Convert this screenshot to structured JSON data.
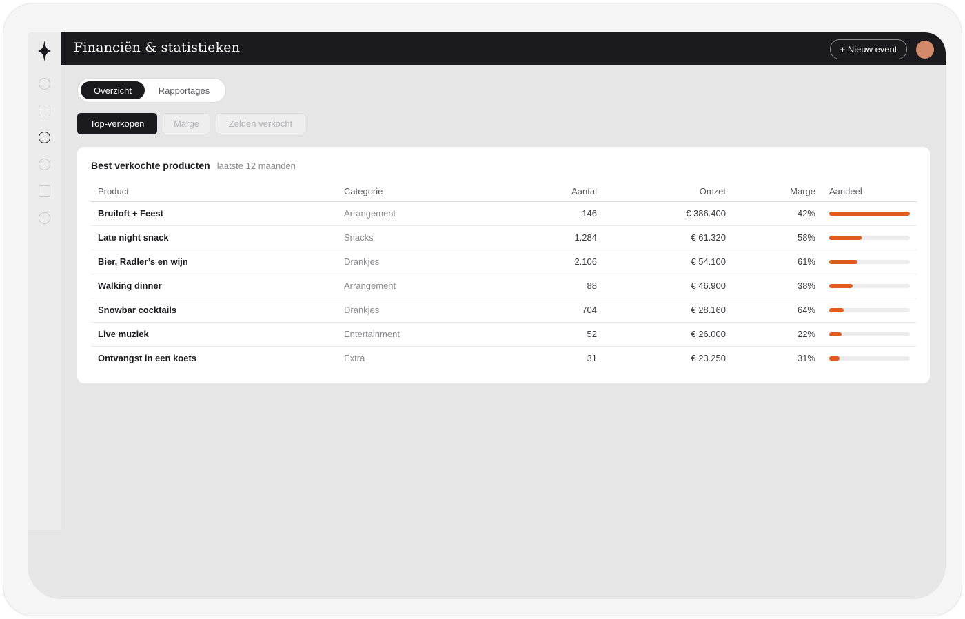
{
  "app": {
    "title": "Financiën & statistieken",
    "new_event_label": "+ Nieuw event",
    "accent_color": "#e05c1f",
    "dark_color": "#1b1b1f"
  },
  "rail": {
    "logo_icon": "four-point-star-icon",
    "items": [
      {
        "shape": "circle",
        "active": false
      },
      {
        "shape": "square",
        "active": false
      },
      {
        "shape": "circle",
        "active": true
      },
      {
        "shape": "circle",
        "active": false
      },
      {
        "shape": "square",
        "active": false
      },
      {
        "shape": "circle",
        "active": false
      }
    ]
  },
  "tabs": {
    "overview": "Overzicht",
    "reports": "Rapportages"
  },
  "filters": {
    "top": "Top-verkopen",
    "margin": "Marge",
    "rarely": "Zelden verkocht"
  },
  "card": {
    "title": "Best verkochte producten",
    "subtitle": "laatste 12 maanden",
    "columns": {
      "product": "Product",
      "category": "Categorie",
      "quantity": "Aantal",
      "revenue": "Omzet",
      "margin": "Marge",
      "share": "Aandeel"
    },
    "rows": [
      {
        "product": "Bruiloft + Feest",
        "category": "Arrangement",
        "quantity": "146",
        "revenue": "€ 386.400",
        "margin": "42%",
        "share": 1.0
      },
      {
        "product": "Late night snack",
        "category": "Snacks",
        "quantity": "1.284",
        "revenue": "€ 61.320",
        "margin": "58%",
        "share": 0.4
      },
      {
        "product": "Bier, Radler’s en wijn",
        "category": "Drankjes",
        "quantity": "2.106",
        "revenue": "€ 54.100",
        "margin": "61%",
        "share": 0.35
      },
      {
        "product": "Walking dinner",
        "category": "Arrangement",
        "quantity": "88",
        "revenue": "€ 46.900",
        "margin": "38%",
        "share": 0.29
      },
      {
        "product": "Snowbar cocktails",
        "category": "Drankjes",
        "quantity": "704",
        "revenue": "€ 28.160",
        "margin": "64%",
        "share": 0.18
      },
      {
        "product": "Live muziek",
        "category": "Entertainment",
        "quantity": "52",
        "revenue": "€ 26.000",
        "margin": "22%",
        "share": 0.15
      },
      {
        "product": "Ontvangst in een koets",
        "category": "Extra",
        "quantity": "31",
        "revenue": "€ 23.250",
        "margin": "31%",
        "share": 0.13
      }
    ]
  }
}
